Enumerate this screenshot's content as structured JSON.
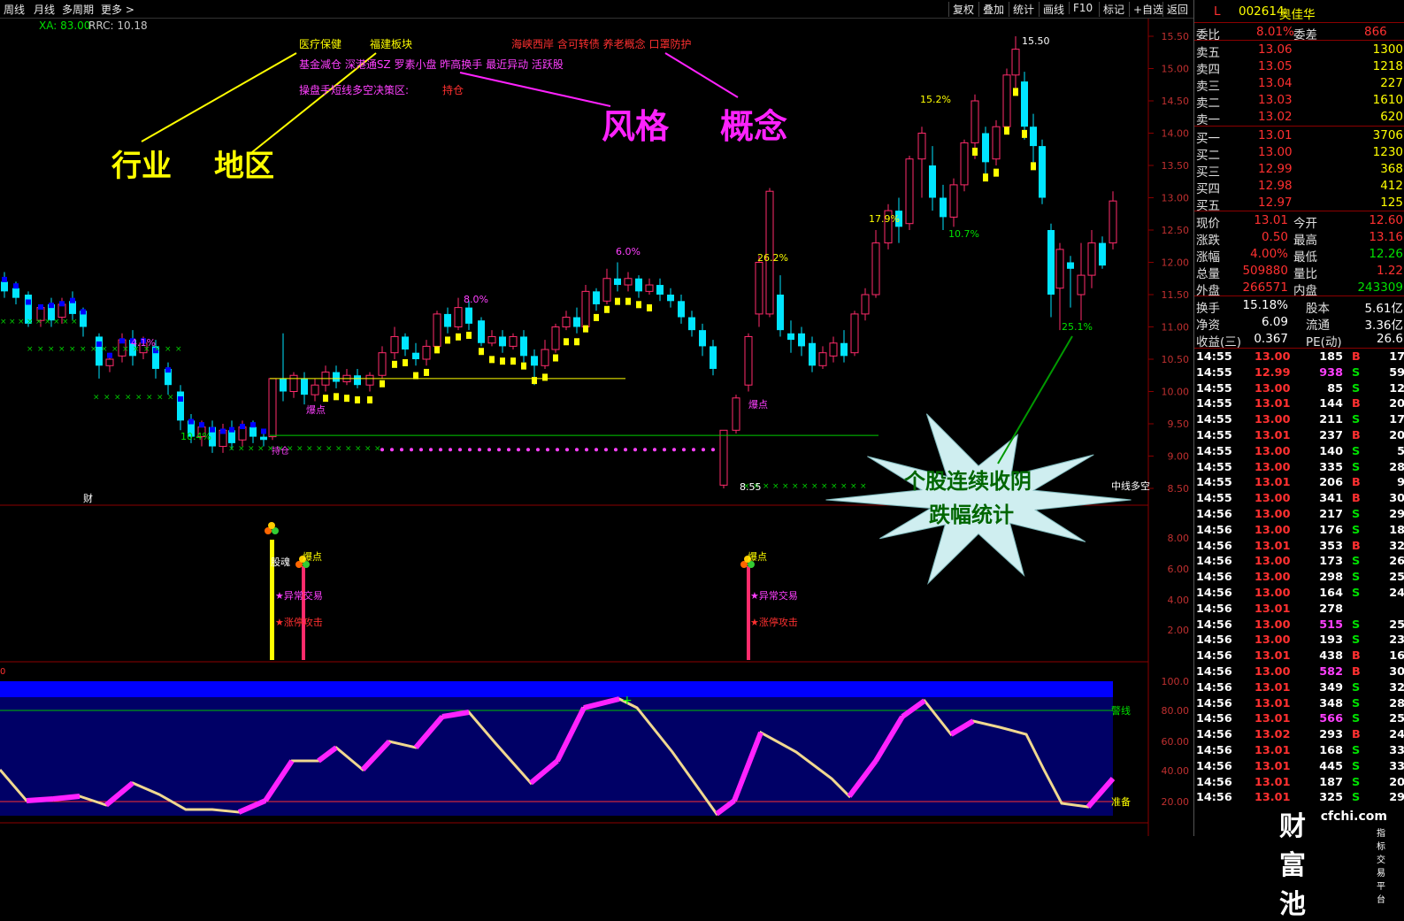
{
  "toolbar": {
    "left": [
      "周线",
      "月线",
      "多周期",
      "更多 >"
    ],
    "right": [
      "复权",
      "叠加",
      "统计",
      "画线",
      "F10",
      "标记",
      "+自选",
      "返回"
    ]
  },
  "indicators": {
    "xa": "XA: 83.00",
    "rrc": "RRC: 10.18"
  },
  "tags": {
    "industry": "医疗保健",
    "region": "福建板块",
    "concepts": "海峡西岸 含可转债 养老概念 口罩防护",
    "styles": "基金减仓 深港通SZ 罗素小盘 昨高换手 最近异动 活跃股",
    "strategy": "操盘手短线多空决策区:",
    "position": "持仓"
  },
  "annotations": {
    "industry": "行业",
    "region": "地区",
    "style": "风格",
    "concept": "概念",
    "burst_line1": "个股连续收阴",
    "burst_line2": "跌幅统计"
  },
  "chart_labels": {
    "high": "15.50",
    "low": "8.55",
    "pcts": [
      "4.1%",
      "10.4%",
      "8.0%",
      "6.0%",
      "26.2%",
      "17.9%",
      "15.2%",
      "10.7%",
      "25.1%"
    ],
    "baodian": "爆点",
    "baodian2": "爆点",
    "tail": "中线多空",
    "cai": "财",
    "shiyi": "持仓"
  },
  "yaxis_main": [
    "15.50",
    "15.00",
    "14.50",
    "14.00",
    "13.50",
    "13.00",
    "12.50",
    "12.00",
    "11.50",
    "11.00",
    "10.50",
    "10.00",
    "9.50",
    "9.00",
    "8.50"
  ],
  "yaxis_mid": [
    "8.00",
    "6.00",
    "4.00",
    "2.00"
  ],
  "yaxis_low": [
    "100.0",
    "80.00",
    "60.00",
    "40.00",
    "20.00"
  ],
  "mid_labels": {
    "guhun": "股魂",
    "baodian_a": "爆点",
    "baodian_b": "爆点",
    "yichang": "★异常交易",
    "yichang2": "★异常交易",
    "zhangting": "★涨停攻击",
    "zhangting2": "★涨停攻击"
  },
  "low_labels": {
    "jingxian": "警线",
    "zhunbei": "准备",
    "zero": "0"
  },
  "stock": {
    "flag": "L",
    "code": "002614",
    "name": "奥佳华"
  },
  "quote": {
    "weibi_label": "委比",
    "weibi": "8.01%",
    "weicha_label": "委差",
    "weicha": "866",
    "asks": [
      {
        "label": "卖五",
        "price": "13.06",
        "vol": "1300"
      },
      {
        "label": "卖四",
        "price": "13.05",
        "vol": "1218"
      },
      {
        "label": "卖三",
        "price": "13.04",
        "vol": "227"
      },
      {
        "label": "卖二",
        "price": "13.03",
        "vol": "1610"
      },
      {
        "label": "卖一",
        "price": "13.02",
        "vol": "620"
      }
    ],
    "bids": [
      {
        "label": "买一",
        "price": "13.01",
        "vol": "3706"
      },
      {
        "label": "买二",
        "price": "13.00",
        "vol": "1230"
      },
      {
        "label": "买三",
        "price": "12.99",
        "vol": "368"
      },
      {
        "label": "买四",
        "price": "12.98",
        "vol": "412"
      },
      {
        "label": "买五",
        "price": "12.97",
        "vol": "125"
      }
    ],
    "stats": [
      {
        "l1": "现价",
        "v1": "13.01",
        "l2": "今开",
        "v2": "12.60",
        "c1": "red",
        "c2": "red"
      },
      {
        "l1": "涨跌",
        "v1": "0.50",
        "l2": "最高",
        "v2": "13.16",
        "c1": "red",
        "c2": "red"
      },
      {
        "l1": "涨幅",
        "v1": "4.00%",
        "l2": "最低",
        "v2": "12.26",
        "c1": "red",
        "c2": "grn"
      },
      {
        "l1": "总量",
        "v1": "509880",
        "l2": "量比",
        "v2": "1.22",
        "c1": "red",
        "c2": "red"
      },
      {
        "l1": "外盘",
        "v1": "266571",
        "l2": "内盘",
        "v2": "243309",
        "c1": "red",
        "c2": "grn"
      }
    ],
    "stats2": [
      {
        "l1": "换手",
        "v1": "15.18%",
        "l2": "股本",
        "v2": "5.61亿"
      },
      {
        "l1": "净资",
        "v1": "6.09",
        "l2": "流通",
        "v2": "3.36亿"
      },
      {
        "l1": "收益(三)",
        "v1": "0.367",
        "l2": "PE(动)",
        "v2": "26.6"
      }
    ]
  },
  "ticks": [
    {
      "t": "14:55",
      "p": "13.00",
      "v": "185",
      "s": "B",
      "n": "17",
      "vc": "white"
    },
    {
      "t": "14:55",
      "p": "12.99",
      "v": "938",
      "s": "S",
      "n": "59",
      "vc": "mag"
    },
    {
      "t": "14:55",
      "p": "13.00",
      "v": "85",
      "s": "S",
      "n": "12",
      "vc": "white"
    },
    {
      "t": "14:55",
      "p": "13.01",
      "v": "144",
      "s": "B",
      "n": "20",
      "vc": "white"
    },
    {
      "t": "14:55",
      "p": "13.00",
      "v": "211",
      "s": "S",
      "n": "17",
      "vc": "white"
    },
    {
      "t": "14:55",
      "p": "13.01",
      "v": "237",
      "s": "B",
      "n": "20",
      "vc": "white"
    },
    {
      "t": "14:55",
      "p": "13.00",
      "v": "140",
      "s": "S",
      "n": "5",
      "vc": "white"
    },
    {
      "t": "14:55",
      "p": "13.00",
      "v": "335",
      "s": "S",
      "n": "28",
      "vc": "white"
    },
    {
      "t": "14:55",
      "p": "13.01",
      "v": "206",
      "s": "B",
      "n": "9",
      "vc": "white"
    },
    {
      "t": "14:55",
      "p": "13.00",
      "v": "341",
      "s": "B",
      "n": "30",
      "vc": "white"
    },
    {
      "t": "14:56",
      "p": "13.00",
      "v": "217",
      "s": "S",
      "n": "29",
      "vc": "white"
    },
    {
      "t": "14:56",
      "p": "13.00",
      "v": "176",
      "s": "S",
      "n": "18",
      "vc": "white"
    },
    {
      "t": "14:56",
      "p": "13.01",
      "v": "353",
      "s": "B",
      "n": "32",
      "vc": "white"
    },
    {
      "t": "14:56",
      "p": "13.00",
      "v": "173",
      "s": "S",
      "n": "26",
      "vc": "white"
    },
    {
      "t": "14:56",
      "p": "13.00",
      "v": "298",
      "s": "S",
      "n": "25",
      "vc": "white"
    },
    {
      "t": "14:56",
      "p": "13.00",
      "v": "164",
      "s": "S",
      "n": "24",
      "vc": "white"
    },
    {
      "t": "14:56",
      "p": "13.01",
      "v": "278",
      "s": "",
      "n": "",
      "vc": "white"
    },
    {
      "t": "14:56",
      "p": "13.00",
      "v": "515",
      "s": "S",
      "n": "25",
      "vc": "mag"
    },
    {
      "t": "14:56",
      "p": "13.00",
      "v": "193",
      "s": "S",
      "n": "23",
      "vc": "white"
    },
    {
      "t": "14:56",
      "p": "13.01",
      "v": "438",
      "s": "B",
      "n": "16",
      "vc": "white"
    },
    {
      "t": "14:56",
      "p": "13.00",
      "v": "582",
      "s": "B",
      "n": "30",
      "vc": "mag"
    },
    {
      "t": "14:56",
      "p": "13.01",
      "v": "349",
      "s": "S",
      "n": "32",
      "vc": "white"
    },
    {
      "t": "14:56",
      "p": "13.01",
      "v": "348",
      "s": "S",
      "n": "28",
      "vc": "white"
    },
    {
      "t": "14:56",
      "p": "13.01",
      "v": "566",
      "s": "S",
      "n": "25",
      "vc": "mag"
    },
    {
      "t": "14:56",
      "p": "13.02",
      "v": "293",
      "s": "B",
      "n": "24",
      "vc": "white"
    },
    {
      "t": "14:56",
      "p": "13.01",
      "v": "168",
      "s": "S",
      "n": "33",
      "vc": "white"
    },
    {
      "t": "14:56",
      "p": "13.01",
      "v": "445",
      "s": "S",
      "n": "33",
      "vc": "white"
    },
    {
      "t": "14:56",
      "p": "13.01",
      "v": "187",
      "s": "S",
      "n": "20",
      "vc": "white"
    },
    {
      "t": "14:56",
      "p": "13.01",
      "v": "325",
      "s": "S",
      "n": "29",
      "vc": "white"
    }
  ],
  "watermark": {
    "brand": "财富池",
    "site": "cfchi.com",
    "sub": "指标交易平台"
  },
  "colors": {
    "up": "#ff2b6b",
    "down": "#00e5ff",
    "ma": "#ffff00",
    "kdj_up": "#ff22ff",
    "kdj_dn": "#f0d890",
    "band": "#0000ff",
    "bg_band": "#000066"
  }
}
